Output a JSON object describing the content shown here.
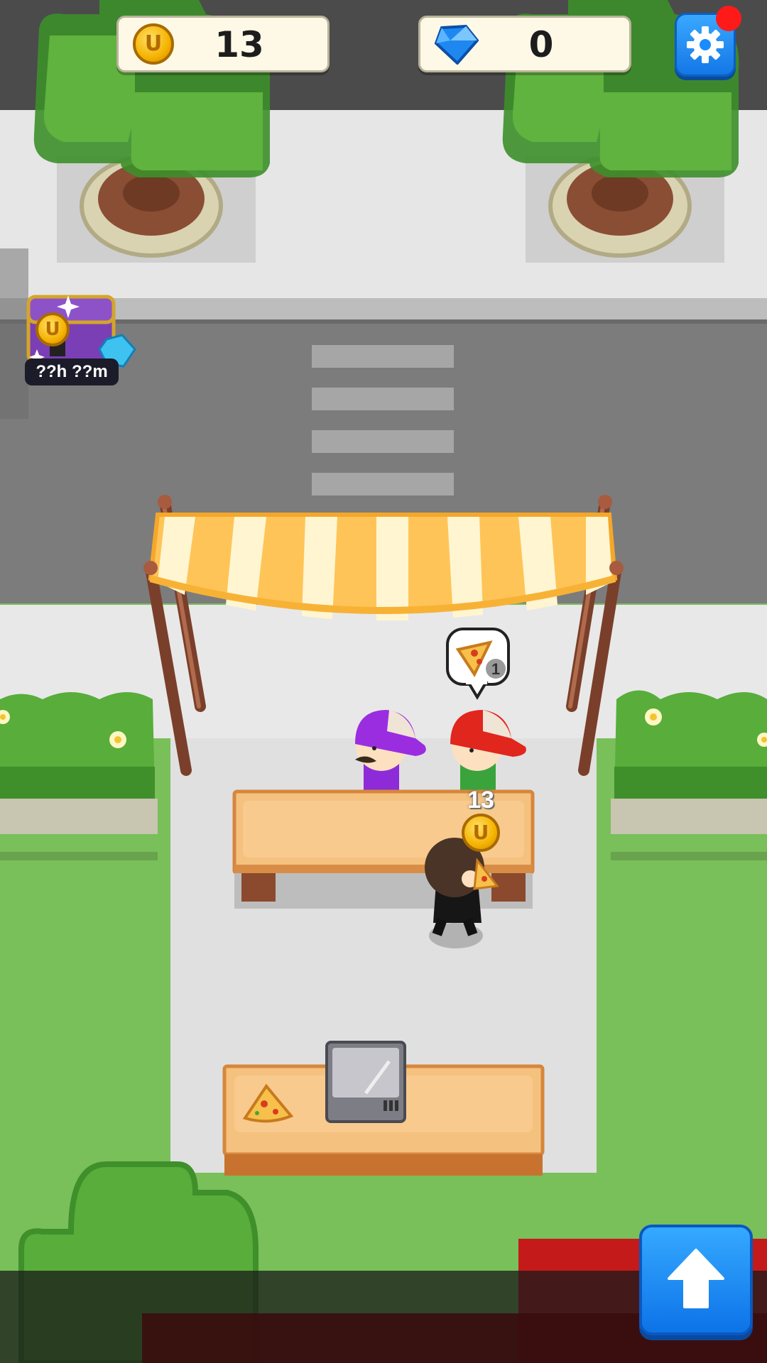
{
  "hud": {
    "coins": "13",
    "gems": "0",
    "coin_icon": "coin-icon",
    "gem_icon": "gem-icon",
    "settings_icon": "gear-icon"
  },
  "chest": {
    "timer": "??h ??m",
    "coin_letter": "U"
  },
  "order_bubble": {
    "item": "pizza-slice",
    "count": "1"
  },
  "floating_reward": {
    "amount": "13",
    "coin_letter": "U"
  },
  "colors": {
    "accent_blue": "#1a8cff",
    "coin_gold": "#f5b301",
    "notification_red": "#ff1a1a",
    "grass": "#79bf5a",
    "counter": "#f5c17f"
  }
}
